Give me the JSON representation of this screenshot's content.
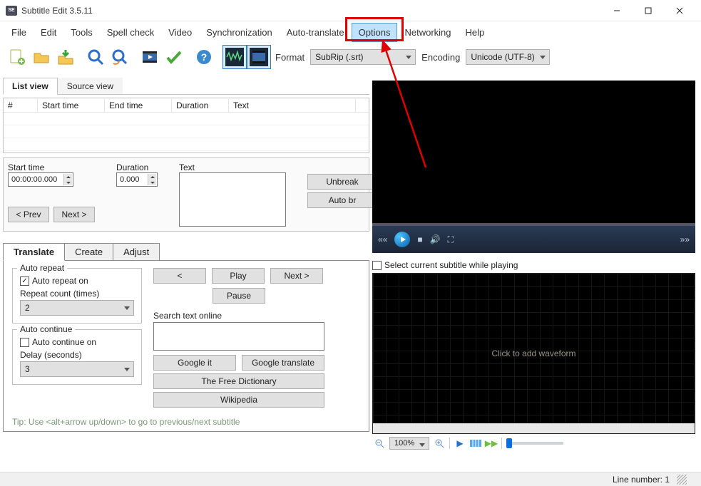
{
  "title": "Subtitle Edit 3.5.11",
  "menu": [
    "File",
    "Edit",
    "Tools",
    "Spell check",
    "Video",
    "Synchronization",
    "Auto-translate",
    "Options",
    "Networking",
    "Help"
  ],
  "highlighted_menu_index": 7,
  "format_label": "Format",
  "format_value": "SubRip (.srt)",
  "encoding_label": "Encoding",
  "encoding_value": "Unicode (UTF-8)",
  "listview": {
    "tabs": [
      "List view",
      "Source view"
    ],
    "active": 0,
    "cols": {
      "num": "#",
      "start": "Start time",
      "end": "End time",
      "dur": "Duration",
      "text": "Text"
    }
  },
  "edit": {
    "start_label": "Start time",
    "start_val": "00:00:00.000",
    "dur_label": "Duration",
    "dur_val": "0.000",
    "text_label": "Text",
    "unbreak": "Unbreak",
    "autobr": "Auto br",
    "prev": "< Prev",
    "next": "Next >"
  },
  "trtabs": {
    "tabs": [
      "Translate",
      "Create",
      "Adjust"
    ],
    "active": 0
  },
  "trans": {
    "auto_repeat_legend": "Auto repeat",
    "auto_repeat_on": "Auto repeat on",
    "repeat_count_label": "Repeat count (times)",
    "repeat_count_val": "2",
    "auto_continue_legend": "Auto continue",
    "auto_continue_on": "Auto continue on",
    "delay_label": "Delay (seconds)",
    "delay_val": "3",
    "nav_prev": "<",
    "nav_play": "Play",
    "nav_next": "Next >",
    "nav_pause": "Pause",
    "search_label": "Search text online",
    "google": "Google it",
    "gtrans": "Google translate",
    "freedict": "The Free Dictionary",
    "wiki": "Wikipedia",
    "tip": "Tip: Use <alt+arrow up/down> to go to previous/next subtitle"
  },
  "wave": {
    "checkbox": "Select current subtitle while playing",
    "placeholder": "Click to add waveform",
    "zoom": "100%"
  },
  "status": {
    "line": "Line number: 1"
  }
}
